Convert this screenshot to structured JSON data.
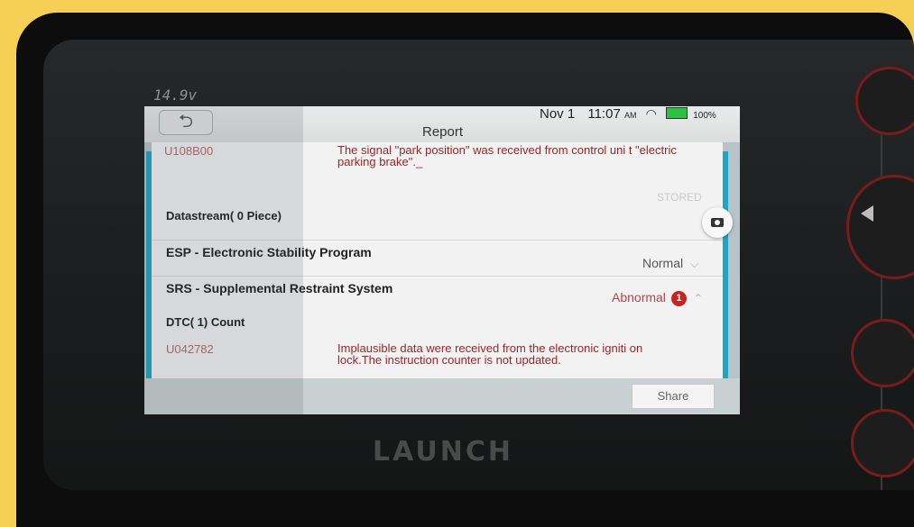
{
  "device": {
    "voltage": "14.9v",
    "brand": "LAUNCH"
  },
  "statusbar": {
    "date": "Nov 1",
    "time": "11:07",
    "ampm": "AM",
    "battery": "100%"
  },
  "header": {
    "back_icon": "back-arrow-icon",
    "title": "Report"
  },
  "report": {
    "top_dtc": {
      "code": "U108B00",
      "description": "The signal \"park position\" was received from control uni t \"electric parking brake\"._",
      "state": "STORED"
    },
    "datastream_label": "Datastream( 0 Piece)",
    "systems": [
      {
        "name": "ESP - Electronic Stability Program",
        "status": "Normal"
      },
      {
        "name": "SRS - Supplemental Restraint System",
        "status": "Abnormal",
        "badge": "1",
        "dtc_count_label": "DTC( 1) Count",
        "dtcs": [
          {
            "code": "U042782",
            "description": "Implausible data were received from the electronic igniti on lock.The instruction counter is not updated."
          }
        ]
      }
    ]
  },
  "footer": {
    "share_label": "Share"
  },
  "colors": {
    "frame": "#f6cf55",
    "accent": "#21a4c2",
    "dtc_text": "#9c2626",
    "badge": "#c8231f",
    "battery": "#2bc23f"
  }
}
